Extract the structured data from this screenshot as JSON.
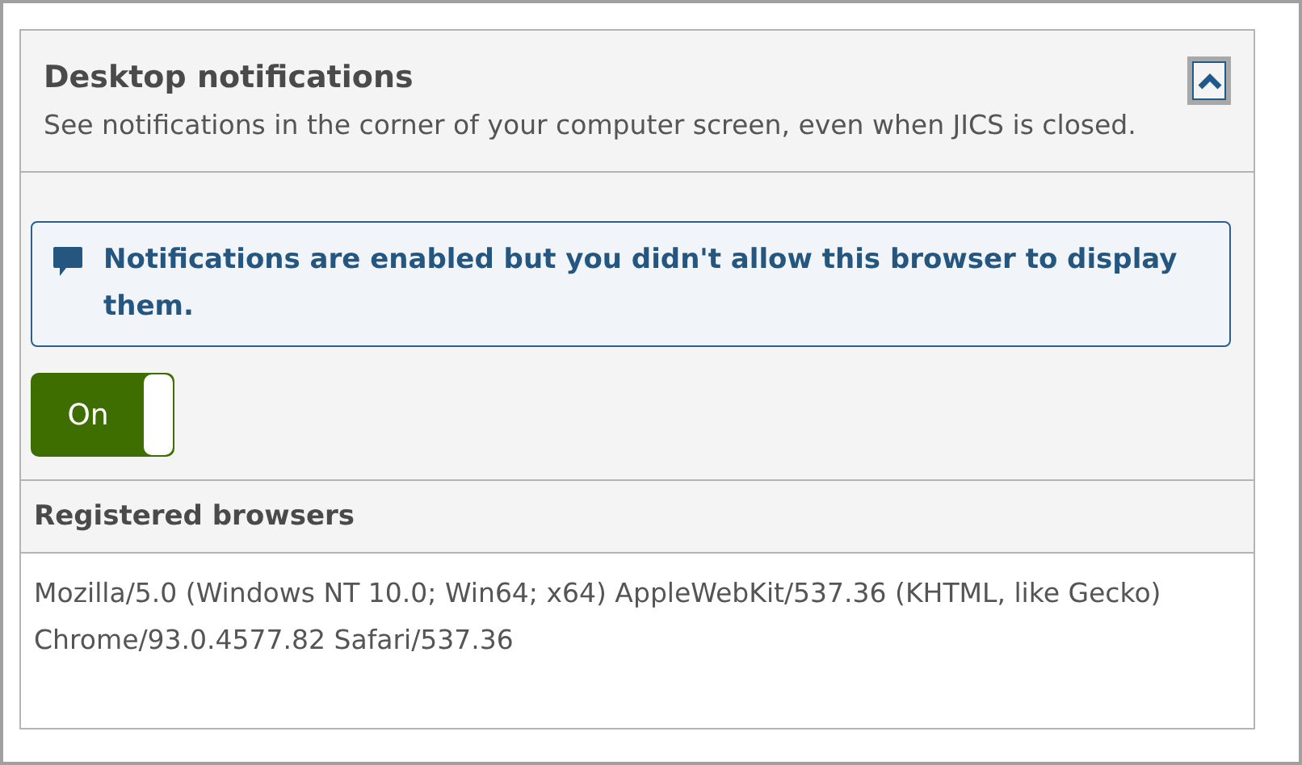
{
  "panel": {
    "title": "Desktop notifications",
    "description": "See notifications in the corner of your computer screen, even when JICS is closed.",
    "expanded": true
  },
  "alert": {
    "message": "Notifications are enabled but you didn't allow this browser to display them."
  },
  "toggle": {
    "label": "On",
    "on": true
  },
  "registered_browsers": {
    "heading": "Registered browsers",
    "items": [
      "Mozilla/5.0 (Windows NT 10.0; Win64; x64) AppleWebKit/537.36 (KHTML, like Gecko) Chrome/93.0.4577.82 Safari/537.36"
    ]
  }
}
